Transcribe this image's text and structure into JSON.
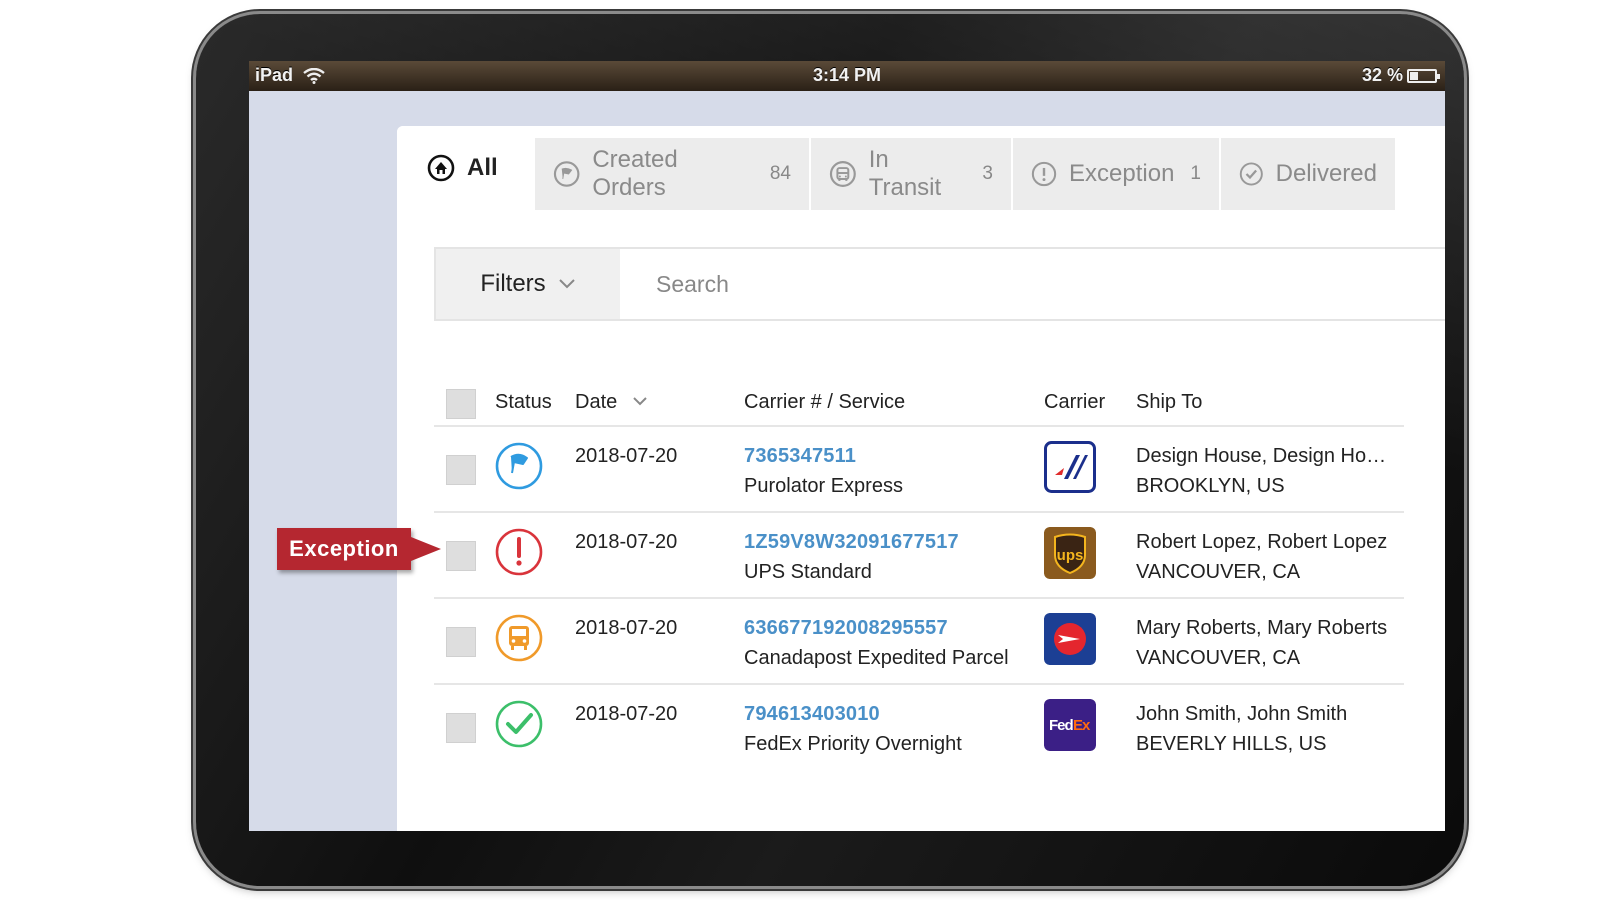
{
  "statusbar": {
    "device": "iPad",
    "time": "3:14 PM",
    "battery": "32 %",
    "battery_level": 0.32
  },
  "tabs": [
    {
      "label": "All",
      "count": "",
      "icon": "home-icon"
    },
    {
      "label": "Created Orders",
      "count": "84",
      "icon": "flag-circle-icon"
    },
    {
      "label": "In Transit",
      "count": "3",
      "icon": "bus-circle-icon"
    },
    {
      "label": "Exception",
      "count": "1",
      "icon": "exclamation-circle-icon"
    },
    {
      "label": "Delivered",
      "count": "",
      "icon": "check-circle-icon"
    }
  ],
  "filters": {
    "label": "Filters"
  },
  "search": {
    "placeholder": "Search"
  },
  "table": {
    "headers": {
      "status": "Status",
      "date": "Date",
      "carrier_service": "Carrier # / Service",
      "carrier": "Carrier",
      "ship_to": "Ship To"
    },
    "rows": [
      {
        "status": "created-flag-icon",
        "status_color": "#2f9be0",
        "date": "2018-07-20",
        "tracking": "7365347511",
        "service": "Purolator Express",
        "carrier_logo": "purolator-logo",
        "ship_line1": "Design House, Design Ho…",
        "ship_line2": "BROOKLYN, US"
      },
      {
        "status": "exception-icon",
        "status_color": "#d9343b",
        "date": "2018-07-20",
        "tracking": "1Z59V8W32091677517",
        "service": "UPS Standard",
        "carrier_logo": "ups-logo",
        "ship_line1": "Robert Lopez, Robert Lopez",
        "ship_line2": "VANCOUVER, CA"
      },
      {
        "status": "in-transit-bus-icon",
        "status_color": "#f09a2a",
        "date": "2018-07-20",
        "tracking": "636677192008295557",
        "service": "Canadapost Expedited Parcel",
        "carrier_logo": "canadapost-logo",
        "ship_line1": "Mary Roberts, Mary Roberts",
        "ship_line2": "VANCOUVER, CA"
      },
      {
        "status": "delivered-check-icon",
        "status_color": "#3cbf6a",
        "date": "2018-07-20",
        "tracking": "794613403010",
        "service": "FedEx Priority Overnight",
        "carrier_logo": "fedex-logo",
        "ship_line1": "John Smith, John Smith",
        "ship_line2": "BEVERLY HILLS, US"
      }
    ]
  },
  "callout": {
    "label": "Exception"
  },
  "colors": {
    "link": "#4a90c8",
    "callout": "#b52730",
    "screen_bg": "#d6dbe9"
  }
}
